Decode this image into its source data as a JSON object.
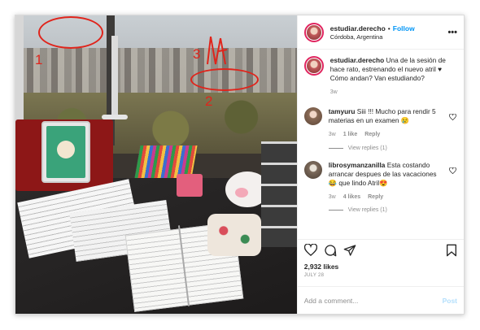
{
  "post": {
    "username": "estudiar.derecho",
    "separator": "•",
    "follow_label": "Follow",
    "location": "Córdoba, Argentina",
    "more_label": "•••",
    "caption_user": "estudiar.derecho",
    "caption_text": "Una de la sesión de hace rato, estrenando el nuevo atril ♥ Cómo andan? Van estudiando?",
    "caption_age": "3w",
    "likes": "2,932 likes",
    "date": "JULY 28",
    "comment_placeholder": "Add a comment...",
    "post_label": "Post"
  },
  "photo": {
    "annotations": [
      "1",
      "2",
      "3"
    ],
    "annotation_color": "#e0241b"
  },
  "comments": [
    {
      "user": "tamyuru",
      "text": "Siii !!! Mucho para rendir 5 materias en un examen 😢",
      "age": "3w",
      "likes": "1 like",
      "reply": "Reply",
      "view_replies": "View replies (1)"
    },
    {
      "user": "librosymanzanilla",
      "text": "Esta costando arrancar despues de las vacaciones 😂 que lindo Atril😍",
      "age": "3w",
      "likes": "4 likes",
      "reply": "Reply",
      "view_replies": "View replies (1)"
    }
  ],
  "icons": {
    "heart": "heart-icon",
    "comment": "comment-icon",
    "share": "share-icon",
    "save": "bookmark-icon"
  },
  "colors": {
    "follow": "#0095f6",
    "post_disabled": "#b3dffc",
    "muted": "#8e8e8e"
  }
}
